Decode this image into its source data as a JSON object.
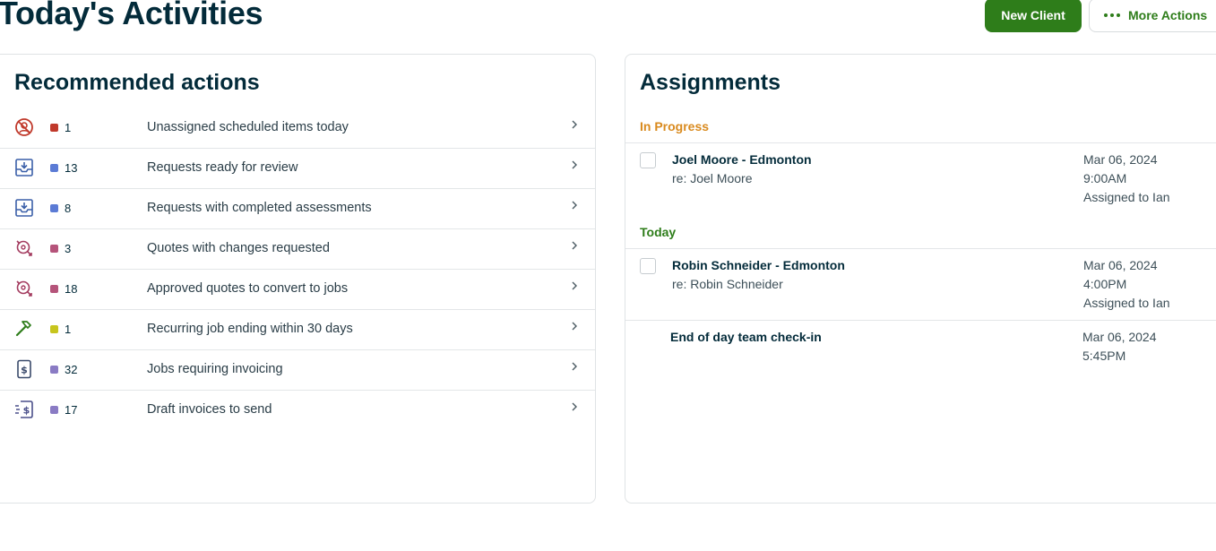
{
  "page": {
    "title": "Today's Activities"
  },
  "header": {
    "new_client_label": "New Client",
    "more_actions_label": "More Actions"
  },
  "recommended": {
    "title": "Recommended actions",
    "items": [
      {
        "icon": "unassigned-icon",
        "color": "#c0392b",
        "count": "1",
        "label": "Unassigned scheduled items today"
      },
      {
        "icon": "inbox-download-icon",
        "color": "#5b7bd5",
        "count": "13",
        "label": "Requests ready for review"
      },
      {
        "icon": "inbox-download-icon",
        "color": "#5b7bd5",
        "count": "8",
        "label": "Requests with completed assessments"
      },
      {
        "icon": "quote-icon",
        "color": "#b5547a",
        "count": "3",
        "label": "Quotes with changes requested"
      },
      {
        "icon": "quote-icon",
        "color": "#b5547a",
        "count": "18",
        "label": "Approved quotes to convert to jobs"
      },
      {
        "icon": "hammer-icon",
        "color": "#c7c51d",
        "count": "1",
        "label": "Recurring job ending within 30 days"
      },
      {
        "icon": "invoice-icon",
        "color": "#8a7bc4",
        "count": "32",
        "label": "Jobs requiring invoicing"
      },
      {
        "icon": "draft-invoice-icon",
        "color": "#8a7bc4",
        "count": "17",
        "label": "Draft invoices to send"
      }
    ]
  },
  "assignments": {
    "title": "Assignments",
    "sections": [
      {
        "label": "In Progress",
        "color": "#d98a1e",
        "items": [
          {
            "title": "Joel Moore - Edmonton",
            "subtitle": "re: Joel Moore",
            "date": "Mar 06, 2024",
            "time": "9:00AM",
            "assigned": "Assigned to Ian"
          }
        ]
      },
      {
        "label": "Today",
        "color": "#2e7d1a",
        "items": [
          {
            "title": "Robin Schneider - Edmonton",
            "subtitle": "re: Robin Schneider",
            "date": "Mar 06, 2024",
            "time": "4:00PM",
            "assigned": "Assigned to Ian"
          },
          {
            "title": "End of day team check-in",
            "date": "Mar 06, 2024",
            "time": "5:45PM"
          }
        ]
      }
    ]
  },
  "colors": {
    "brand_green": "#2e7d1a",
    "text_dark": "#032b3a",
    "in_progress": "#d98a1e"
  }
}
